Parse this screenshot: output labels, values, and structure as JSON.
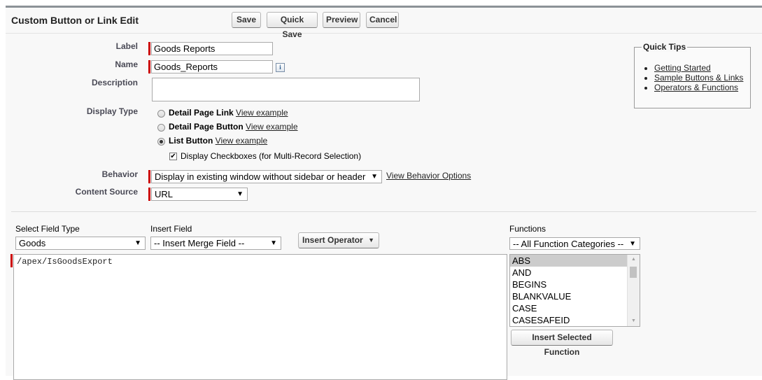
{
  "header": {
    "title": "Custom Button or Link Edit",
    "save": "Save",
    "quick_save": "Quick Save",
    "preview": "Preview",
    "cancel": "Cancel"
  },
  "form": {
    "label_label": "Label",
    "label_value": "Goods Reports",
    "name_label": "Name",
    "name_value": "Goods_Reports",
    "description_label": "Description",
    "description_value": "",
    "display_type_label": "Display Type",
    "display_options": [
      {
        "label": "Detail Page Link",
        "link": "View example",
        "selected": false
      },
      {
        "label": "Detail Page Button",
        "link": "View example",
        "selected": false
      },
      {
        "label": "List Button",
        "link": "View example",
        "selected": true
      }
    ],
    "checkbox_label": "Display Checkboxes (for Multi-Record Selection)",
    "checkbox_checked": true,
    "behavior_label": "Behavior",
    "behavior_value": "Display in existing window without sidebar or header",
    "behavior_link": "View Behavior Options",
    "content_source_label": "Content Source",
    "content_source_value": "URL"
  },
  "quick_tips": {
    "title": "Quick Tips",
    "items": [
      "Getting Started",
      "Sample Buttons & Links",
      "Operators & Functions"
    ]
  },
  "editor": {
    "field_type_label": "Select Field Type",
    "field_type_value": "Goods",
    "insert_field_label": "Insert Field",
    "insert_field_value": "-- Insert Merge Field --",
    "insert_operator": "Insert Operator",
    "functions_label": "Functions",
    "functions_category": "-- All Function Categories --",
    "functions": [
      "ABS",
      "AND",
      "BEGINS",
      "BLANKVALUE",
      "CASE",
      "CASESAFEID"
    ],
    "insert_function": "Insert Selected Function",
    "code": "/apex/IsGoodsExport"
  },
  "colors": {
    "required": "#cc0000",
    "header_border": "#8c9297"
  }
}
